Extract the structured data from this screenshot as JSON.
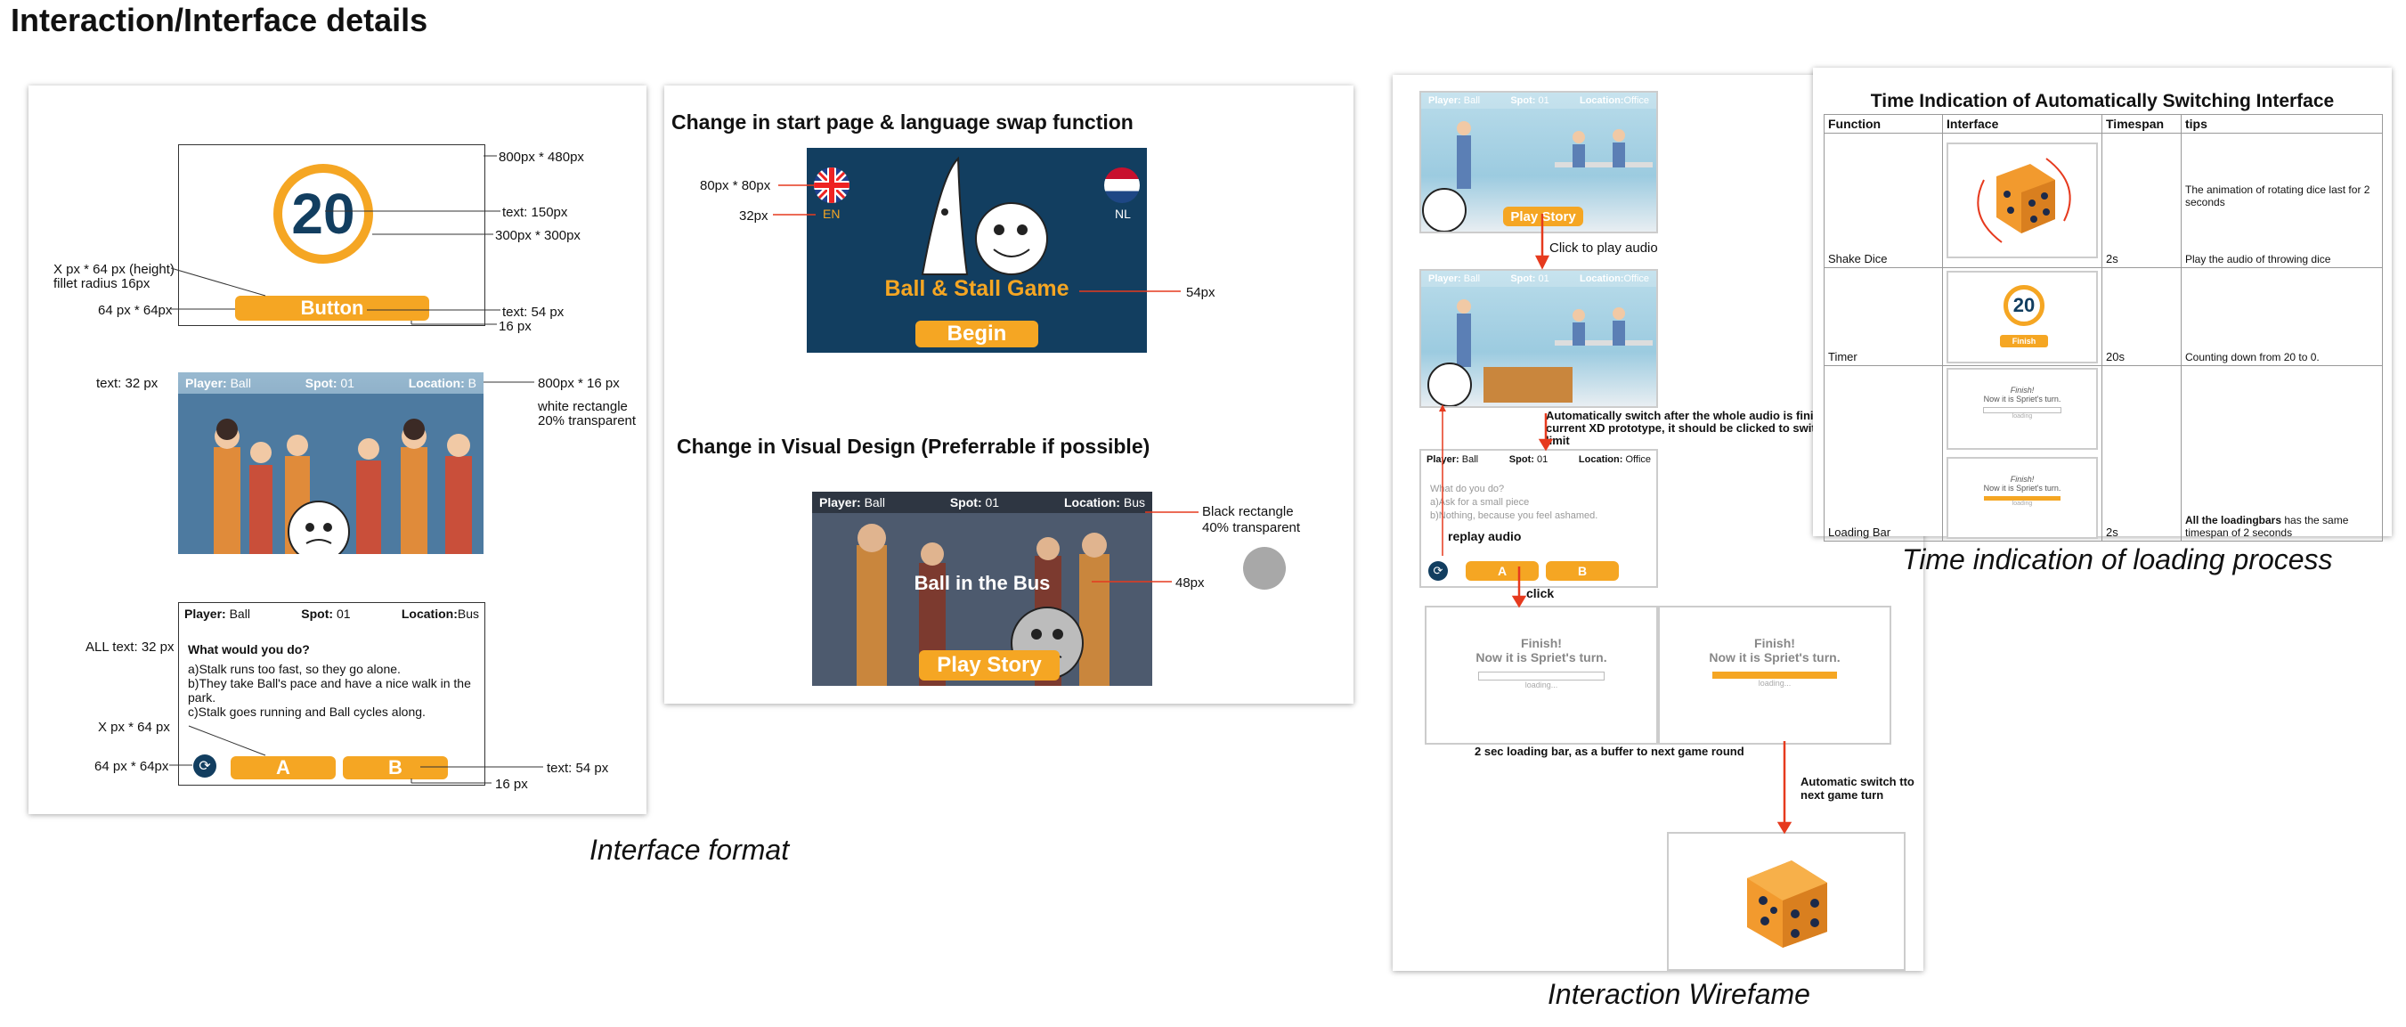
{
  "page": {
    "title": "Interaction/Interface details"
  },
  "colors": {
    "orange": "#f5a623",
    "navy": "#123e60",
    "red": "#e63a1e",
    "grey": "#a8a8a8"
  },
  "format_panel": {
    "caption": "Interface format",
    "timer_value": "20",
    "button_label": "Button",
    "labels": {
      "size_800_480": "800px * 480px",
      "text_150": "text: 150px",
      "size_300": "300px * 300px",
      "x_64_height": "X px * 64 px (height)",
      "fillet": "fillet radius 16px",
      "size_64_64": "64 px * 64px",
      "text_54": "text: 54 px",
      "px16": "16 px",
      "text_32": "text: 32 px",
      "size_800_16": "800px * 16 px",
      "white_rect": "white rectangle",
      "transp_20": "20% transparent",
      "all_text": "ALL text: 32 px",
      "x_64": "X px * 64 px",
      "size_64_64b": "64 px * 64px",
      "text_54b": "text: 54 px",
      "px16b": "16 px"
    },
    "hud": {
      "player_label": "Player:",
      "player": "Ball",
      "spot_label": "Spot:",
      "spot": "01",
      "location_label": "Location:",
      "location": "B"
    },
    "question_card": {
      "player_label": "Player:",
      "player": "Ball",
      "spot_label": "Spot:",
      "spot": "01",
      "location_label": "Location:",
      "location": "Bus",
      "question": "What would you do?",
      "option_a": "a)Stalk runs too fast, so they go alone.",
      "option_b": "b)They take Ball's pace and have a nice walk in the park.",
      "option_c": "c)Stalk goes running and Ball cycles along.",
      "btn_a": "A",
      "btn_b": "B"
    }
  },
  "start_panel": {
    "heading1": "Change in start page & language swap function",
    "heading2": "Change in Visual Design (Preferrable if possible)",
    "flag_en": "EN",
    "flag_nl": "NL",
    "game_title": "Ball & Stall Game",
    "begin": "Begin",
    "labels": {
      "size_80": "80px * 80px",
      "px32": "32px",
      "px54": "54px",
      "black_rect": "Black rectangle",
      "transp_40": "40% transparent",
      "px48": "48px"
    },
    "bus_screen": {
      "player_label": "Player:",
      "player": "Ball",
      "spot_label": "Spot:",
      "spot": "01",
      "location_label": "Location:",
      "location": "Bus",
      "title": "Ball in the Bus",
      "play": "Play Story"
    }
  },
  "wireframe_panel": {
    "caption": "Interaction Wirefame",
    "hud1": {
      "player_label": "Player:",
      "player": "Ball",
      "spot_label": "Spot:",
      "spot": "01",
      "location_label": "Location:",
      "location": "Office"
    },
    "play_story": "Play Story",
    "click_audio": "Click to play audio",
    "auto_switch": "Automatically switch after the whole audio is finished (but in current XD prototype, it should be clicked to switch due to tech limit",
    "q_header": {
      "player_label": "Player:",
      "player": "Ball",
      "spot_label": "Spot:",
      "spot": "01",
      "location_label": "Location:",
      "location": "Office"
    },
    "q_text1": "What do you do?",
    "q_text2": "a)Ask for a small piece",
    "q_text3": "b)Nothing, because you feel ashamed.",
    "replay": "replay audio",
    "btn_a": "A",
    "btn_b": "B",
    "click": "click",
    "finish": "Finish!",
    "turn": "Now it is Spriet's turn.",
    "loading": "loading...",
    "loading_note": "2 sec loading bar, as a buffer to next game round",
    "auto_next": "Automatic switch  tto next game turn"
  },
  "table_panel": {
    "title": "Time Indication of Automatically Switching Interface",
    "caption": "Time indication of loading process",
    "headers": [
      "Function",
      "Interface",
      "Timespan",
      "tips"
    ],
    "rows": [
      {
        "function": "Shake Dice",
        "timespan": "2s",
        "tip1": "The animation of rotating dice last for 2 seconds",
        "tip2": "Play the audio of throwing dice"
      },
      {
        "function": "Timer",
        "timespan": "20s",
        "tip1": "Counting down from 20 to 0."
      },
      {
        "function": "Loading Bar",
        "timespan": "2s",
        "tip_bold": "All the loadingbars",
        "tip_rest": " has the same timespan of 2 seconds"
      }
    ],
    "timer_value": "20",
    "finish_btn": "Finish",
    "finish": "Finish!",
    "turn": "Now it is Spriet's turn.",
    "loading": "loading"
  }
}
